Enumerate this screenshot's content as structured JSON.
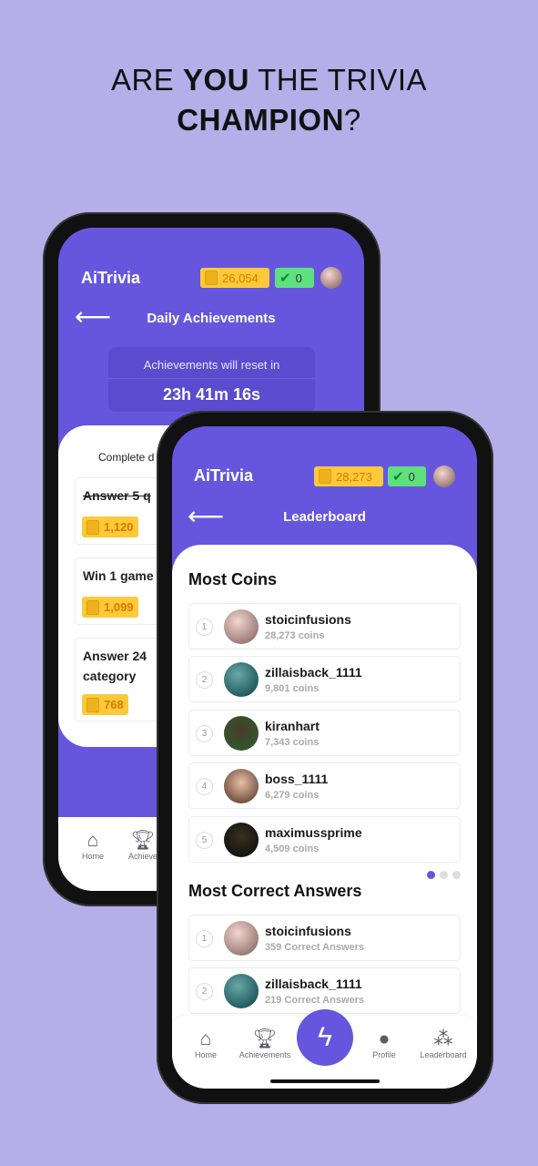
{
  "headline": {
    "part1": "ARE ",
    "bold1": "YOU",
    "part2": " THE TRIVIA",
    "bold2": "CHAMPION",
    "part3": "?"
  },
  "colors": {
    "background": "#b4afe9",
    "brand_purple": "#6656de",
    "coin_badge": "#fbc93a",
    "check_badge": "#5ee07f"
  },
  "back_phone": {
    "app_name": "AiTrivia",
    "coins": "26,054",
    "correct": "0",
    "title": "Daily Achievements",
    "timer_label": "Achievements will reset in",
    "timer_value": "23h 41m 16s",
    "intro": "Complete d",
    "achievements": [
      {
        "text": "Answer 5 q",
        "reward": "1,120",
        "completed": true
      },
      {
        "text": "Win 1 game",
        "reward": "1,099",
        "completed": false
      },
      {
        "text": "Answer 24",
        "text2": "category",
        "reward": "768",
        "completed": false
      }
    ],
    "nav": [
      {
        "label": "Home",
        "icon": "home-icon"
      },
      {
        "label": "Achieve",
        "icon": "trophy-icon"
      }
    ]
  },
  "front_phone": {
    "app_name": "AiTrivia",
    "coins": "28,273",
    "correct": "0",
    "title": "Leaderboard",
    "most_coins": {
      "heading": "Most Coins",
      "rows": [
        {
          "rank": "1",
          "name": "stoicinfusions",
          "stat": "28,273 coins"
        },
        {
          "rank": "2",
          "name": "zillaisback_1111",
          "stat": "9,801 coins"
        },
        {
          "rank": "3",
          "name": "kiranhart",
          "stat": "7,343 coins"
        },
        {
          "rank": "4",
          "name": "boss_1111",
          "stat": "6,279 coins"
        },
        {
          "rank": "5",
          "name": "maximussprime",
          "stat": "4,509 coins"
        }
      ]
    },
    "page_dots": {
      "count": 3,
      "active": 1
    },
    "most_correct": {
      "heading": "Most Correct Answers",
      "rows": [
        {
          "rank": "1",
          "name": "stoicinfusions",
          "stat": "359 Correct Answers"
        },
        {
          "rank": "2",
          "name": "zillaisback_1111",
          "stat": "219 Correct Answers"
        }
      ]
    },
    "nav": [
      {
        "label": "Home",
        "icon": "home-icon"
      },
      {
        "label": "Achievements",
        "icon": "trophy-icon"
      },
      {
        "label": "",
        "icon": "lightning-icon"
      },
      {
        "label": "Profile",
        "icon": "profile-icon"
      },
      {
        "label": "Leaderboard",
        "icon": "group-icon"
      }
    ]
  }
}
